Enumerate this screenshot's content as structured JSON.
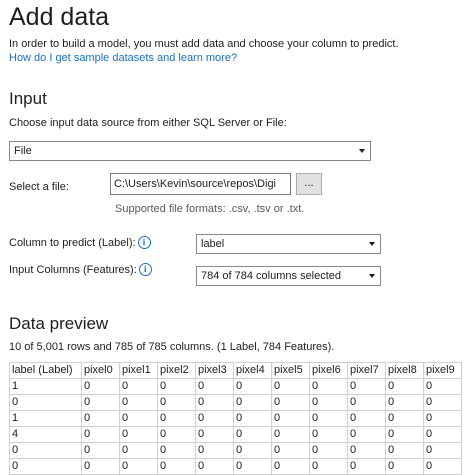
{
  "header": {
    "title": "Add data",
    "description": "In order to build a model, you must add data and choose your column to predict.",
    "help_link": "How do I get sample datasets and learn more?"
  },
  "input": {
    "heading": "Input",
    "source_prompt": "Choose input data source from either SQL Server or File:",
    "source_value": "File",
    "file_label": "Select a file:",
    "file_path": "C:\\Users\\Kevin\\source\\repos\\Digi",
    "browse_label": "...",
    "formats_hint": "Supported file formats: .csv, .tsv or .txt.",
    "predict_label": "Column to predict (Label):",
    "predict_value": "label",
    "features_label": "Input Columns (Features):",
    "features_value": "784 of 784 columns selected",
    "info_glyph": "i"
  },
  "preview": {
    "heading": "Data preview",
    "summary": "10 of 5,001 rows and 785 of 785 columns. (1 Label, 784 Features).",
    "columns": [
      "label (Label)",
      "pixel0",
      "pixel1",
      "pixel2",
      "pixel3",
      "pixel4",
      "pixel5",
      "pixel6",
      "pixel7",
      "pixel8",
      "pixel9"
    ],
    "rows": [
      [
        "1",
        "0",
        "0",
        "0",
        "0",
        "0",
        "0",
        "0",
        "0",
        "0",
        "0"
      ],
      [
        "0",
        "0",
        "0",
        "0",
        "0",
        "0",
        "0",
        "0",
        "0",
        "0",
        "0"
      ],
      [
        "1",
        "0",
        "0",
        "0",
        "0",
        "0",
        "0",
        "0",
        "0",
        "0",
        "0"
      ],
      [
        "4",
        "0",
        "0",
        "0",
        "0",
        "0",
        "0",
        "0",
        "0",
        "0",
        "0"
      ],
      [
        "0",
        "0",
        "0",
        "0",
        "0",
        "0",
        "0",
        "0",
        "0",
        "0",
        "0"
      ],
      [
        "0",
        "0",
        "0",
        "0",
        "0",
        "0",
        "0",
        "0",
        "0",
        "0",
        "0"
      ]
    ]
  },
  "colors": {
    "link": "#1a6fc0",
    "border": "#8a8a8a",
    "text": "#1e1e1e"
  }
}
